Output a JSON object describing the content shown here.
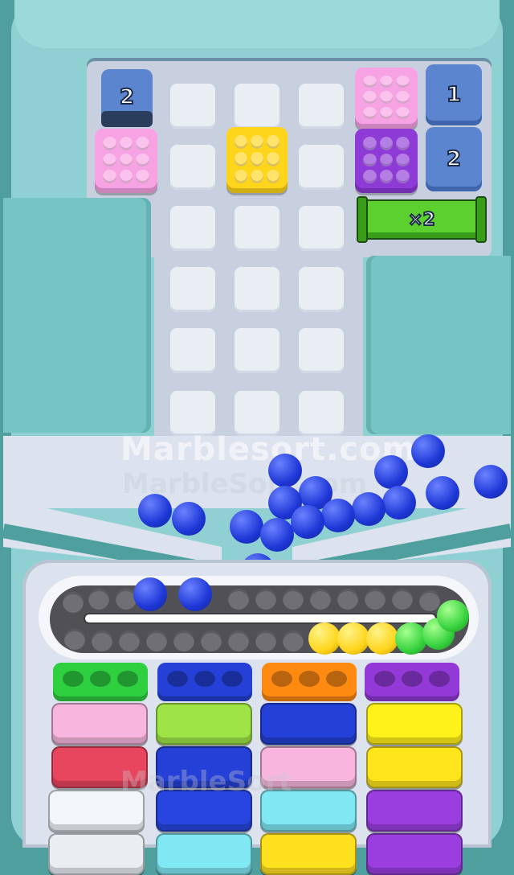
{
  "colors": {
    "frame": "#5aa9a9",
    "board": "#c8d0e0",
    "pink": "#f7a2e2",
    "yellow": "#ffd51c",
    "purple": "#8d3ad6",
    "blue_marble": "#1e37d6",
    "green": "#37d33f"
  },
  "board": {
    "queue_top_left": {
      "label": "2",
      "icon": "blue-container-tab"
    },
    "queue_top_right": [
      {
        "label": "1",
        "icon": "blue-container-tab"
      },
      {
        "label": "2",
        "icon": "blue-container-tab"
      }
    ],
    "multiplier": {
      "label": "×2"
    }
  },
  "watermark": {
    "main": "Marblesort.com",
    "faint": "MarbleSort.com",
    "bottom": "MarbleSort"
  },
  "conveyor": {
    "marbles_on_track": [
      "yellow",
      "yellow",
      "yellow",
      "green",
      "green",
      "green"
    ]
  },
  "tubes": [
    {
      "cap": "green",
      "layers": [
        "pink",
        "red",
        "white",
        "white"
      ]
    },
    {
      "cap": "blue",
      "layers": [
        "lime",
        "blue",
        "blue",
        "cyan"
      ]
    },
    {
      "cap": "orange",
      "layers": [
        "blue",
        "pink",
        "cyan",
        "yellow"
      ]
    },
    {
      "cap": "purple",
      "layers": [
        "yellow",
        "yellow",
        "purple",
        "purple"
      ]
    }
  ]
}
